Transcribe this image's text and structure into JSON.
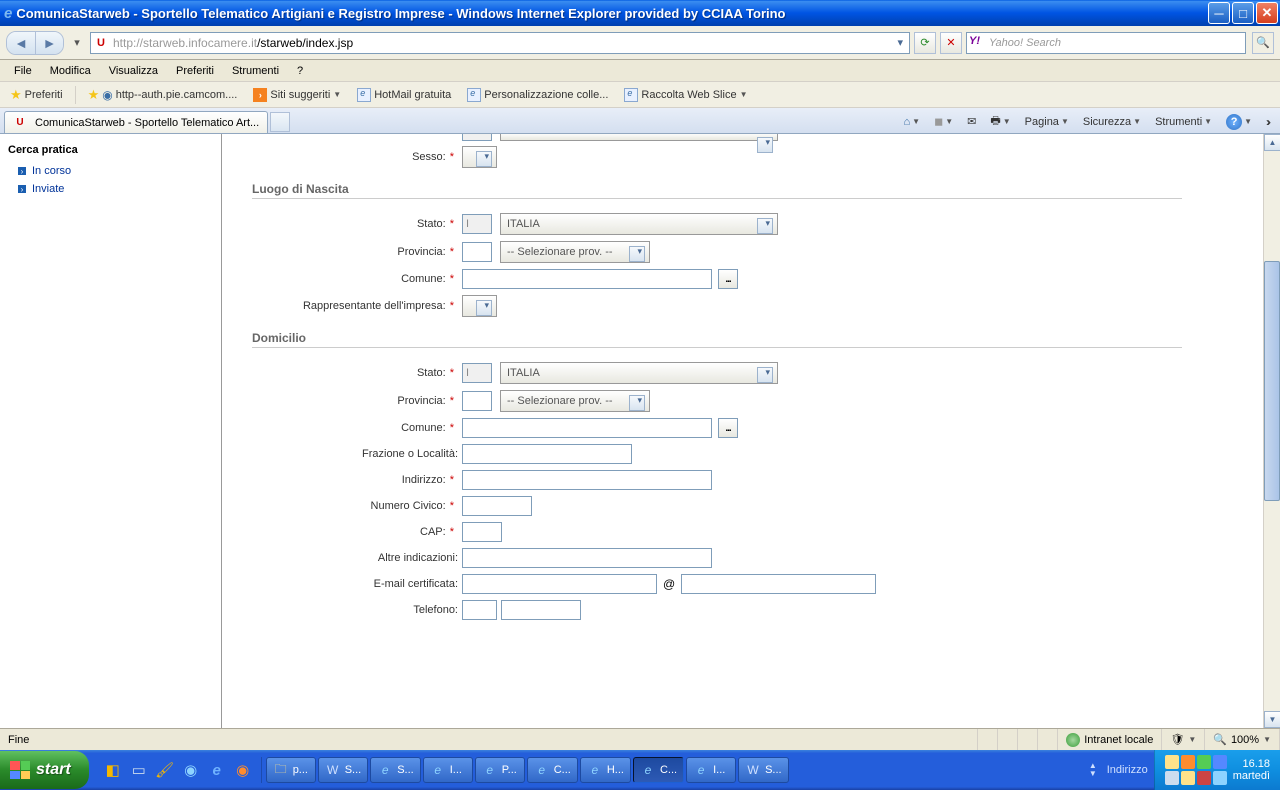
{
  "titlebar": {
    "title": "ComunicaStarweb - Sportello Telematico Artigiani e Registro Imprese - Windows Internet Explorer provided by CCIAA Torino"
  },
  "url": {
    "host": "http://starweb.infocamere.it",
    "path": "/starweb/index.jsp"
  },
  "search": {
    "placeholder": "Yahoo! Search"
  },
  "menu": {
    "file": "File",
    "modifica": "Modifica",
    "visualizza": "Visualizza",
    "preferiti": "Preferiti",
    "strumenti": "Strumenti",
    "help": "?"
  },
  "favbar": {
    "preferiti": "Preferiti",
    "items": [
      "http--auth.pie.camcom....",
      "Siti suggeriti",
      "HotMail gratuita",
      "Personalizzazione colle...",
      "Raccolta Web Slice"
    ]
  },
  "tab": {
    "title": "ComunicaStarweb - Sportello Telematico Art..."
  },
  "toolbar": {
    "pagina": "Pagina",
    "sicurezza": "Sicurezza",
    "strumenti": "Strumenti"
  },
  "sidebar": {
    "title": "Cerca pratica",
    "items": [
      "In corso",
      "Inviate"
    ]
  },
  "form": {
    "sesso_label": "Sesso:",
    "birth_section": "Luogo di Nascita",
    "stato_label": "Stato:",
    "stato_code": "I",
    "stato_value": "ITALIA",
    "provincia_label": "Provincia:",
    "provincia_placeholder": "-- Selezionare prov. --",
    "comune_label": "Comune:",
    "rapp_label": "Rappresentante dell'impresa:",
    "dom_section": "Domicilio",
    "frazione_label": "Frazione o Località:",
    "indirizzo_label": "Indirizzo:",
    "civico_label": "Numero Civico:",
    "cap_label": "CAP:",
    "altre_label": "Altre indicazioni:",
    "email_label": "E-mail certificata:",
    "at": "@",
    "telefono_label": "Telefono:",
    "lookup": "..."
  },
  "status": {
    "left": "Fine",
    "zone": "Intranet locale",
    "zoom": "100%"
  },
  "taskbar": {
    "start": "start",
    "windows": [
      "p...",
      "S...",
      "S...",
      "I...",
      "P...",
      "C...",
      "H...",
      "C...",
      "I...",
      "S..."
    ],
    "indirizzo": "Indirizzo",
    "time": "16.18",
    "day": "martedì"
  }
}
